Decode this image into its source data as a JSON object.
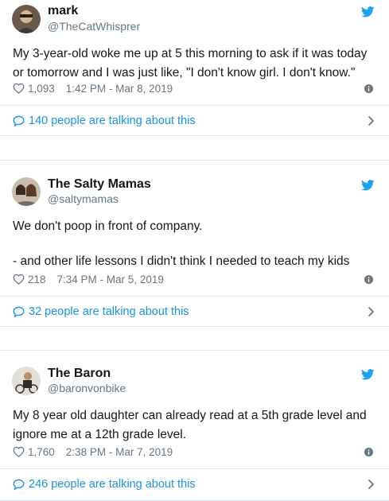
{
  "colors": {
    "link": "#1b95e0",
    "muted": "#657786",
    "text": "#14171a",
    "border": "#e1e8ed"
  },
  "tweets": [
    {
      "name": "mark",
      "handle": "@TheCatWhisprer",
      "text_lines": [
        "My 3-year-old woke me up at 5 this morning to ask if it was today",
        "or tomorrow and I was just like, \"I don't know girl. I don't know.\""
      ],
      "likes": "1,093",
      "timestamp": "1:42 PM - Mar 8, 2019",
      "talking": "140 people are talking about this"
    },
    {
      "name": "The Salty Mamas",
      "handle": "@saltymamas",
      "text_lines": [
        "We don't poop in front of company.",
        "",
        "- and other life lessons I didn't think I needed to teach my kids"
      ],
      "likes": "218",
      "timestamp": "7:34 PM - Mar 5, 2019",
      "talking": "32 people are talking about this"
    },
    {
      "name": "The Baron",
      "handle": "@baronvonbike",
      "text_lines": [
        "My 8 year old daughter can already read at a 5th grade level and",
        "ignore me at a 12th grade level."
      ],
      "likes": "1,760",
      "timestamp": "2:38 PM - Mar 7, 2019",
      "talking": "246 people are talking about this"
    }
  ]
}
